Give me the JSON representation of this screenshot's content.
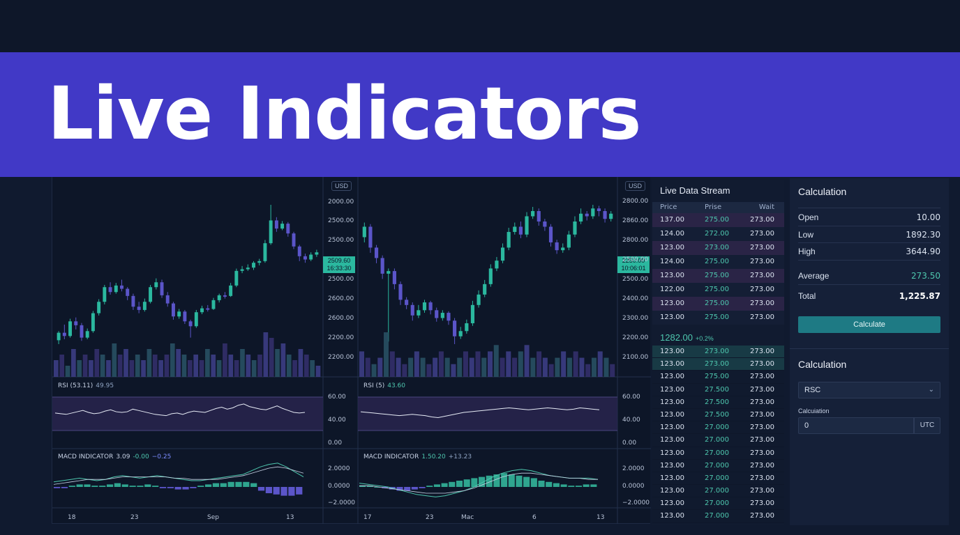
{
  "banner": {
    "title": "Live Indicators"
  },
  "charts": [
    {
      "usd_label": "USD",
      "price_tag": {
        "price": "2509.60",
        "time": "16:33:30"
      },
      "y_labels": [
        "2000.00",
        "2500.00",
        "2500.00",
        "2500.00",
        "2600.00",
        "2600.00",
        "2200.00",
        "2200.00"
      ],
      "rsi": {
        "name": "RSI (53.11)",
        "value": "49.95",
        "y_labels": [
          "60.00",
          "40.00",
          "0.00"
        ]
      },
      "macd": {
        "name": "MACD INDICATOR",
        "v1": "3.09",
        "v2": "-0.00",
        "v3": "−0.25",
        "y_labels": [
          "2.0000",
          "0.0000",
          "−2.0000"
        ]
      },
      "x_labels": [
        "18",
        "23",
        "Sep",
        "13"
      ]
    },
    {
      "usd_label": "USD",
      "price_tag": {
        "price": "2250.00",
        "time": "10:06:01"
      },
      "y_labels": [
        "2800.00",
        "2860.00",
        "2800.00",
        "2500.00",
        "2500.00",
        "2400.00",
        "2300.00",
        "2200.00",
        "2100.00"
      ],
      "rsi": {
        "name": "RSI (5)",
        "value": "43.60",
        "y_labels": [
          "60.00",
          "40.00",
          "0.00"
        ]
      },
      "macd": {
        "name": "MACD INDICATOR",
        "v1": "1.50.20",
        "v2": "+13.23",
        "y_labels": [
          "2.0000",
          "0.0000",
          "−2.0000"
        ]
      },
      "x_labels": [
        "17",
        "23",
        "Mac",
        "6",
        "13"
      ]
    }
  ],
  "chart_data": [
    {
      "type": "candlestick",
      "x_labels": [
        "18",
        "23",
        "Sep",
        "13"
      ],
      "ohlc": [
        [
          2182,
          2205,
          2170,
          2210
        ],
        [
          2205,
          2195,
          2185,
          2230
        ],
        [
          2195,
          2240,
          2190,
          2248
        ],
        [
          2240,
          2228,
          2215,
          2252
        ],
        [
          2228,
          2190,
          2180,
          2235
        ],
        [
          2190,
          2210,
          2185,
          2218
        ],
        [
          2210,
          2265,
          2205,
          2272
        ],
        [
          2265,
          2300,
          2258,
          2308
        ],
        [
          2300,
          2345,
          2292,
          2352
        ],
        [
          2345,
          2330,
          2322,
          2360
        ],
        [
          2330,
          2350,
          2325,
          2358
        ],
        [
          2350,
          2340,
          2332,
          2368
        ],
        [
          2340,
          2318,
          2305,
          2345
        ],
        [
          2318,
          2285,
          2275,
          2325
        ],
        [
          2285,
          2275,
          2265,
          2300
        ],
        [
          2275,
          2300,
          2270,
          2310
        ],
        [
          2300,
          2345,
          2295,
          2352
        ],
        [
          2345,
          2360,
          2338,
          2372
        ],
        [
          2360,
          2320,
          2312,
          2368
        ],
        [
          2320,
          2295,
          2285,
          2330
        ],
        [
          2295,
          2255,
          2245,
          2300
        ],
        [
          2255,
          2270,
          2248,
          2278
        ],
        [
          2270,
          2240,
          2232,
          2275
        ],
        [
          2240,
          2225,
          2190,
          2245
        ],
        [
          2225,
          2268,
          2220,
          2275
        ],
        [
          2268,
          2280,
          2262,
          2288
        ],
        [
          2280,
          2278,
          2270,
          2290
        ],
        [
          2278,
          2305,
          2275,
          2312
        ],
        [
          2305,
          2320,
          2298,
          2325
        ],
        [
          2320,
          2318,
          2310,
          2330
        ],
        [
          2318,
          2350,
          2315,
          2358
        ],
        [
          2350,
          2395,
          2345,
          2402
        ],
        [
          2395,
          2400,
          2388,
          2410
        ],
        [
          2400,
          2405,
          2395,
          2415
        ],
        [
          2405,
          2420,
          2398,
          2425
        ],
        [
          2420,
          2425,
          2412,
          2432
        ],
        [
          2425,
          2480,
          2420,
          2490
        ],
        [
          2480,
          2550,
          2475,
          2598
        ],
        [
          2550,
          2525,
          2515,
          2560
        ],
        [
          2525,
          2540,
          2520,
          2548
        ],
        [
          2540,
          2510,
          2500,
          2545
        ],
        [
          2510,
          2470,
          2462,
          2515
        ],
        [
          2470,
          2440,
          2425,
          2475
        ],
        [
          2440,
          2430,
          2420,
          2448
        ],
        [
          2430,
          2445,
          2425,
          2452
        ],
        [
          2445,
          2452,
          2438,
          2460
        ]
      ],
      "volume": [
        3,
        4,
        2,
        5,
        3,
        4,
        3,
        5,
        4,
        3,
        6,
        4,
        5,
        3,
        4,
        3,
        5,
        4,
        3,
        4,
        6,
        5,
        4,
        3,
        4,
        3,
        5,
        4,
        3,
        6,
        4,
        3,
        5,
        4,
        3,
        4,
        8,
        7,
        5,
        6,
        4,
        3,
        5,
        4,
        3,
        2
      ],
      "rsi": [
        44,
        43,
        42,
        44,
        46,
        48,
        45,
        43,
        44,
        47,
        49,
        46,
        45,
        46,
        50,
        48,
        46,
        44,
        42,
        41,
        40,
        43,
        44,
        42,
        45,
        47,
        46,
        45,
        48,
        51,
        53,
        50,
        52,
        56,
        58,
        54,
        52,
        50,
        49,
        52,
        55,
        51,
        48,
        45,
        44,
        45
      ],
      "macd_fast": [
        0.4,
        0.5,
        0.6,
        0.7,
        0.6,
        0.5,
        0.6,
        0.8,
        0.9,
        0.8,
        0.7,
        0.8,
        0.9,
        0.8,
        0.7,
        0.6,
        0.5,
        0.5,
        0.6,
        0.7,
        0.8,
        0.9,
        1.0,
        1.3,
        1.6,
        1.8,
        1.9,
        1.6,
        1.2,
        0.8
      ],
      "macd_slow": [
        0.2,
        0.3,
        0.4,
        0.5,
        0.6,
        0.6,
        0.6,
        0.7,
        0.8,
        0.8,
        0.8,
        0.8,
        0.8,
        0.8,
        0.7,
        0.7,
        0.6,
        0.6,
        0.6,
        0.6,
        0.7,
        0.8,
        0.9,
        1.1,
        1.3,
        1.5,
        1.6,
        1.5,
        1.3,
        1.1
      ],
      "macd_hist": [
        -0.1,
        -0.1,
        0.1,
        0.2,
        0.2,
        0.1,
        0.1,
        0.2,
        0.3,
        0.2,
        0.1,
        0.1,
        0.2,
        0.1,
        -0.1,
        -0.1,
        -0.2,
        -0.2,
        -0.1,
        0.1,
        0.2,
        0.3,
        0.3,
        0.4,
        0.4,
        0.4,
        0.3,
        -0.3,
        -0.5,
        -0.6,
        -0.7,
        -0.7,
        -0.6
      ]
    },
    {
      "type": "candlestick",
      "x_labels": [
        "17",
        "23",
        "Mac",
        "6",
        "13"
      ],
      "ohlc": [
        [
          2420,
          2440,
          2410,
          2448
        ],
        [
          2440,
          2400,
          2390,
          2445
        ],
        [
          2400,
          2380,
          2370,
          2405
        ],
        [
          2380,
          2350,
          2340,
          2385
        ],
        [
          2350,
          2355,
          2220,
          2360
        ],
        [
          2355,
          2330,
          2320,
          2360
        ],
        [
          2330,
          2300,
          2290,
          2335
        ],
        [
          2300,
          2290,
          2282,
          2305
        ],
        [
          2290,
          2270,
          2260,
          2295
        ],
        [
          2270,
          2280,
          2265,
          2290
        ],
        [
          2280,
          2295,
          2275,
          2300
        ],
        [
          2295,
          2280,
          2272,
          2298
        ],
        [
          2280,
          2265,
          2258,
          2285
        ],
        [
          2265,
          2275,
          2260,
          2280
        ],
        [
          2275,
          2260,
          2252,
          2278
        ],
        [
          2260,
          2230,
          2215,
          2265
        ],
        [
          2230,
          2240,
          2225,
          2248
        ],
        [
          2240,
          2255,
          2235,
          2262
        ],
        [
          2255,
          2290,
          2250,
          2298
        ],
        [
          2290,
          2310,
          2285,
          2318
        ],
        [
          2310,
          2330,
          2305,
          2338
        ],
        [
          2330,
          2360,
          2325,
          2368
        ],
        [
          2360,
          2375,
          2355,
          2382
        ],
        [
          2375,
          2400,
          2370,
          2408
        ],
        [
          2400,
          2430,
          2395,
          2438
        ],
        [
          2430,
          2440,
          2425,
          2448
        ],
        [
          2440,
          2425,
          2418,
          2450
        ],
        [
          2425,
          2460,
          2420,
          2468
        ],
        [
          2460,
          2470,
          2455,
          2478
        ],
        [
          2470,
          2450,
          2442,
          2475
        ],
        [
          2450,
          2440,
          2432,
          2455
        ],
        [
          2440,
          2410,
          2402,
          2445
        ],
        [
          2410,
          2395,
          2388,
          2415
        ],
        [
          2395,
          2400,
          2390,
          2408
        ],
        [
          2400,
          2425,
          2395,
          2432
        ],
        [
          2425,
          2450,
          2420,
          2460
        ],
        [
          2450,
          2465,
          2445,
          2475
        ],
        [
          2465,
          2460,
          2452,
          2470
        ],
        [
          2460,
          2475,
          2455,
          2482
        ],
        [
          2475,
          2470,
          2460,
          2480
        ],
        [
          2470,
          2455,
          2448,
          2475
        ],
        [
          2455,
          2465,
          2450,
          2470
        ]
      ],
      "volume": [
        4,
        3,
        2,
        3,
        7,
        4,
        3,
        2,
        3,
        4,
        3,
        2,
        3,
        4,
        3,
        2,
        3,
        4,
        3,
        4,
        3,
        4,
        5,
        3,
        4,
        3,
        4,
        5,
        3,
        4,
        3,
        2,
        3,
        4,
        3,
        4,
        3,
        2,
        3,
        4,
        3,
        2
      ],
      "rsi": [
        46,
        45,
        44,
        43,
        42,
        41,
        40,
        41,
        42,
        41,
        40,
        38,
        37,
        39,
        41,
        43,
        45,
        46,
        47,
        48,
        49,
        50,
        51,
        52,
        51,
        50,
        49,
        50,
        51,
        52,
        51,
        50,
        49,
        50,
        52,
        51,
        50,
        49
      ],
      "macd_fast": [
        0.3,
        0.2,
        0.1,
        0.0,
        -0.2,
        -0.4,
        -0.6,
        -0.7,
        -0.8,
        -0.7,
        -0.5,
        -0.3,
        0.0,
        0.4,
        0.8,
        1.1,
        1.3,
        1.4,
        1.3,
        1.1,
        0.9,
        0.8,
        0.7,
        0.7,
        0.7,
        0.6
      ],
      "macd_slow": [
        0.1,
        0.1,
        0.0,
        -0.1,
        -0.2,
        -0.3,
        -0.4,
        -0.5,
        -0.5,
        -0.5,
        -0.4,
        -0.3,
        -0.1,
        0.2,
        0.5,
        0.8,
        1.0,
        1.1,
        1.1,
        1.0,
        0.9,
        0.8,
        0.7,
        0.7,
        0.6,
        0.6
      ],
      "macd_hist": [
        0.1,
        0.1,
        0.0,
        -0.1,
        -0.2,
        -0.3,
        -0.3,
        -0.2,
        -0.1,
        0.1,
        0.2,
        0.3,
        0.4,
        0.5,
        0.6,
        0.7,
        0.8,
        0.9,
        1.0,
        1.1,
        1.0,
        0.9,
        0.8,
        0.7,
        0.5,
        0.4,
        0.3,
        0.2,
        0.1,
        0.1,
        0.2,
        0.2
      ]
    }
  ],
  "stream": {
    "title": "Live Data Stream",
    "headers": [
      "Price",
      "Prise",
      "Wait"
    ],
    "rows": [
      [
        "137.00",
        "275.00",
        "273.00"
      ],
      [
        "124.00",
        "272.00",
        "273.00"
      ],
      [
        "123.00",
        "273.00",
        "273.00"
      ],
      [
        "124.00",
        "275.00",
        "273.00"
      ],
      [
        "123.00",
        "275.00",
        "273.00"
      ],
      [
        "122.00",
        "275.00",
        "273.00"
      ],
      [
        "123.00",
        "275.00",
        "273.00"
      ],
      [
        "123.00",
        "275.00",
        "273.00"
      ]
    ],
    "ticker": {
      "price": "1282.00",
      "change": "+0.2%"
    },
    "book_rows": [
      [
        "123.00",
        "273.00",
        "273.00"
      ],
      [
        "123.00",
        "273.00",
        "273.00"
      ],
      [
        "123.00",
        "275.00",
        "273.00"
      ],
      [
        "123.00",
        "27.500",
        "273.00"
      ],
      [
        "123.00",
        "27.500",
        "273.00"
      ],
      [
        "123.00",
        "27.500",
        "273.00"
      ],
      [
        "123.00",
        "27.000",
        "273.00"
      ],
      [
        "123.00",
        "27.000",
        "273.00"
      ],
      [
        "123.00",
        "27.000",
        "273.00"
      ],
      [
        "123.00",
        "27.000",
        "273.00"
      ],
      [
        "123.00",
        "27.000",
        "273.00"
      ],
      [
        "123.00",
        "27.000",
        "273.00"
      ],
      [
        "123.00",
        "27.000",
        "273.00"
      ],
      [
        "123.00",
        "27.000",
        "273.00"
      ]
    ]
  },
  "calculation": {
    "title": "Calculation",
    "open_label": "Open",
    "open_value": "10.00",
    "low_label": "Low",
    "low_value": "1892.30",
    "high_label": "High",
    "high_value": "3644.90",
    "average_label": "Average",
    "average_value": "273.50",
    "total_label": "Total",
    "total_value": "1,225.87",
    "button_label": "Calculate",
    "title2": "Calculation",
    "select_value": "RSC",
    "field_label": "Calcuiation",
    "field_value": "0",
    "unit_label": "UTC"
  },
  "colors": {
    "banner": "#4139c6",
    "bull": "#2bb89f",
    "bear": "#5b55c9",
    "accent": "#4ec7ae"
  }
}
